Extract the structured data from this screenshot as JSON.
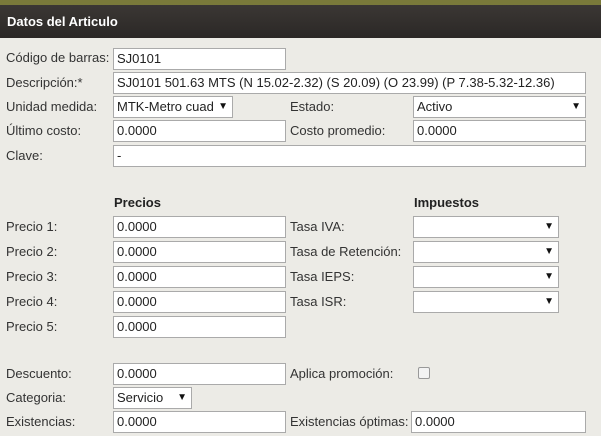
{
  "header": {
    "title": "Datos del Articulo"
  },
  "labels": {
    "codigo": "Código de barras:",
    "descripcion": "Descripción:*",
    "unidad": "Unidad medida:",
    "estado": "Estado:",
    "ultimo_costo": "Último costo:",
    "costo_promedio": "Costo promedio:",
    "clave": "Clave:",
    "precios": "Precios",
    "impuestos": "Impuestos",
    "precio1": "Precio 1:",
    "precio2": "Precio 2:",
    "precio3": "Precio 3:",
    "precio4": "Precio 4:",
    "precio5": "Precio 5:",
    "tasa_iva": "Tasa IVA:",
    "tasa_retencion": "Tasa de Retención:",
    "tasa_ieps": "Tasa IEPS:",
    "tasa_isr": "Tasa ISR:",
    "descuento": "Descuento:",
    "aplica_promocion": "Aplica promoción:",
    "categoria": "Categoria:",
    "existencias": "Existencias:",
    "existencias_optimas": "Existencias óptimas:"
  },
  "values": {
    "codigo": "SJ0101",
    "descripcion": "SJ0101 501.63 MTS (N 15.02-2.32) (S 20.09) (O 23.99) (P 7.38-5.32-12.36)",
    "unidad": "MTK-Metro cuad",
    "estado": "Activo",
    "ultimo_costo": "0.0000",
    "costo_promedio": "0.0000",
    "clave": "-",
    "precio1": "0.0000",
    "precio2": "0.0000",
    "precio3": "0.0000",
    "precio4": "0.0000",
    "precio5": "0.0000",
    "tasa_iva": "",
    "tasa_retencion": "",
    "tasa_ieps": "",
    "tasa_isr": "",
    "descuento": "0.0000",
    "aplica_promocion": false,
    "categoria": "Servicio",
    "existencias": "0.0000",
    "existencias_optimas": "0.0000"
  },
  "icons": {
    "dropdown": "▼"
  }
}
